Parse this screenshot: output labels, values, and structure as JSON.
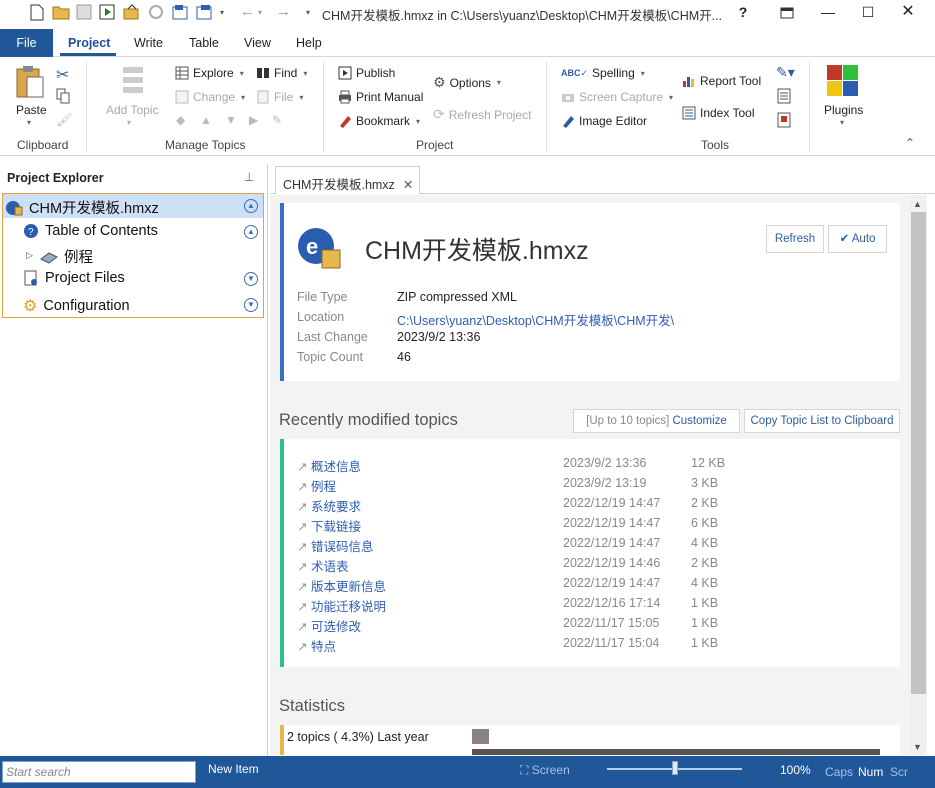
{
  "window": {
    "title": "CHM开发模板.hmxz in C:\\Users\\yuanz\\Desktop\\CHM开发模板\\CHM开...",
    "help": "?"
  },
  "menu": {
    "file": "File",
    "tabs": [
      "Project",
      "Write",
      "Table",
      "View",
      "Help"
    ]
  },
  "ribbon": {
    "clipboard": {
      "paste": "Paste",
      "label": "Clipboard"
    },
    "manage": {
      "add_topic": "Add Topic",
      "explore": "Explore",
      "find": "Find",
      "change": "Change",
      "file": "File",
      "label": "Manage Topics"
    },
    "project": {
      "publish": "Publish",
      "print_manual": "Print Manual",
      "bookmark": "Bookmark",
      "options": "Options",
      "refresh_project": "Refresh Project",
      "label": "Project"
    },
    "tools": {
      "spelling": "Spelling",
      "screen_capture": "Screen Capture",
      "image_editor": "Image Editor",
      "report_tool": "Report Tool",
      "index_tool": "Index Tool",
      "label": "Tools"
    },
    "plugins": "Plugins"
  },
  "explorer": {
    "title": "Project Explorer",
    "root": "CHM开发模板.hmxz",
    "items": [
      {
        "label": "Table of Contents"
      },
      {
        "label": "例程"
      },
      {
        "label": "Project Files"
      },
      {
        "label": "Configuration"
      }
    ]
  },
  "doc_tab": {
    "label": "CHM开发模板.hmxz"
  },
  "info": {
    "title": "CHM开发模板.hmxz",
    "refresh": "Refresh",
    "auto": "Auto",
    "rows": [
      {
        "label": "File Type",
        "value": "ZIP compressed XML"
      },
      {
        "label": "Location",
        "value": "C:\\Users\\yuanz\\Desktop\\CHM开发模板\\CHM开发\\"
      },
      {
        "label": "Last Change",
        "value": "2023/9/2 13:36"
      },
      {
        "label": "Topic Count",
        "value": "46"
      }
    ]
  },
  "recent": {
    "heading": "Recently modified topics",
    "limit_text": "[Up to 10 topics]",
    "customize": "Customize",
    "copy_list": "Copy Topic List to Clipboard",
    "topics": [
      {
        "name": "概述信息",
        "date": "2023/9/2 13:36",
        "size": "12 KB"
      },
      {
        "name": "例程",
        "date": "2023/9/2 13:19",
        "size": "3 KB"
      },
      {
        "name": "系统要求",
        "date": "2022/12/19 14:47",
        "size": "2 KB"
      },
      {
        "name": "下载链接",
        "date": "2022/12/19 14:47",
        "size": "6 KB"
      },
      {
        "name": "错误码信息",
        "date": "2022/12/19 14:47",
        "size": "4 KB"
      },
      {
        "name": "术语表",
        "date": "2022/12/19 14:46",
        "size": "2 KB"
      },
      {
        "name": "版本更新信息",
        "date": "2022/12/19 14:47",
        "size": "4 KB"
      },
      {
        "name": "功能迁移说明",
        "date": "2022/12/16 17:14",
        "size": "1 KB"
      },
      {
        "name": "可选修改",
        "date": "2022/11/17 15:05",
        "size": "1 KB"
      },
      {
        "name": "特点",
        "date": "2022/11/17 15:04",
        "size": "1 KB"
      }
    ]
  },
  "statistics": {
    "heading": "Statistics",
    "line1": "2 topics ( 4.3%) Last year"
  },
  "status": {
    "search_placeholder": "Start search",
    "new_item": "New Item",
    "screen": "Screen",
    "zoom": "100%",
    "zoom_level": 0.5,
    "caps": "Caps",
    "num": "Num",
    "scr": "Scr"
  },
  "colors": {
    "accent": "#1f5799",
    "info_bar": "#3a6fc4",
    "topics_bar": "#2fbf8a",
    "stats_bar": "#e6b84a"
  }
}
